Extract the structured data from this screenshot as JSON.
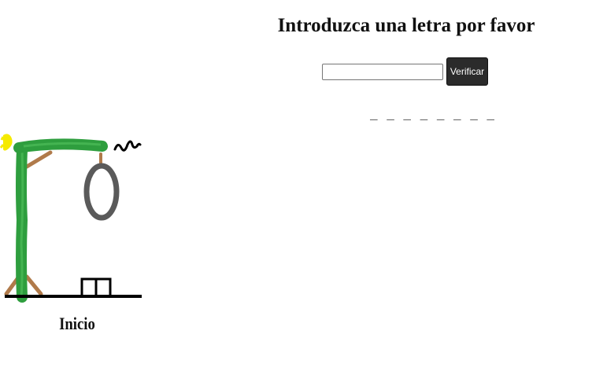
{
  "prompt": {
    "title": "Introduzca una letra por favor"
  },
  "form": {
    "input_value": "",
    "input_placeholder": "",
    "verify_label": "Verificar"
  },
  "word": {
    "display": "_ _ _ _ _ _ _ _"
  },
  "hangman": {
    "stage_label": "Inicio",
    "colors": {
      "post": "#2e9e3e",
      "brace": "#b07a4a",
      "noose": "#5a5a5a",
      "ground": "#000000",
      "sun": "#f2e600"
    }
  }
}
